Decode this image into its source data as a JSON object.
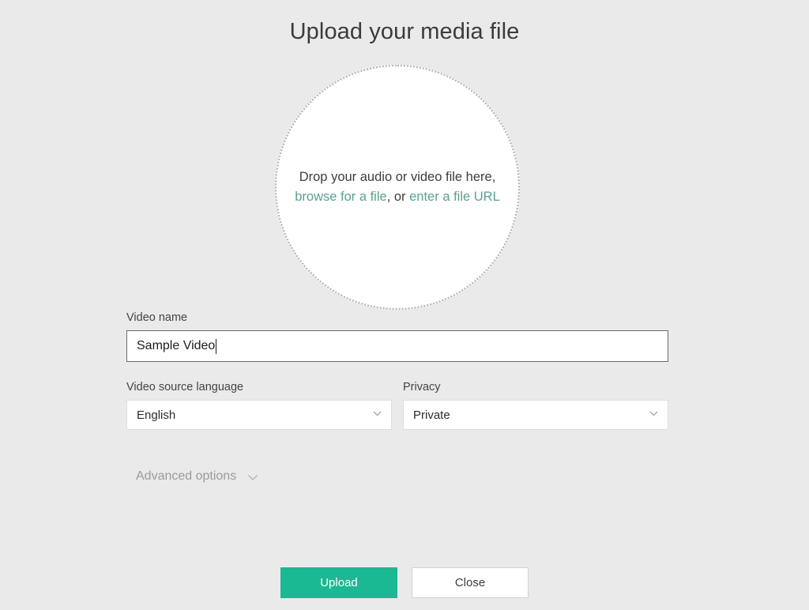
{
  "header": {
    "title": "Upload your media file"
  },
  "dropzone": {
    "line1": "Drop your audio or video file here,",
    "browse_link": "browse for a file",
    "separator": ", or ",
    "url_link": "enter a file URL",
    "icon": "dashed-circle-dropzone"
  },
  "form": {
    "video_name": {
      "label": "Video name",
      "value": "Sample Video",
      "placeholder": "Video name"
    },
    "source_language": {
      "label": "Video source language",
      "value": "English",
      "icon": "chevron-down-icon"
    },
    "privacy": {
      "label": "Privacy",
      "value": "Private",
      "icon": "chevron-down-icon"
    },
    "advanced_options": {
      "label": "Advanced options",
      "icon": "chevron-down-icon"
    }
  },
  "footer": {
    "upload_label": "Upload",
    "close_label": "Close"
  },
  "colors": {
    "background": "#eaeaea",
    "accent": "#1bb894",
    "link": "#5aa193",
    "title_text": "#3b3b3b",
    "input_border": "#6b6b6b",
    "select_border": "#dedede",
    "muted_text": "#9a9a9a"
  }
}
